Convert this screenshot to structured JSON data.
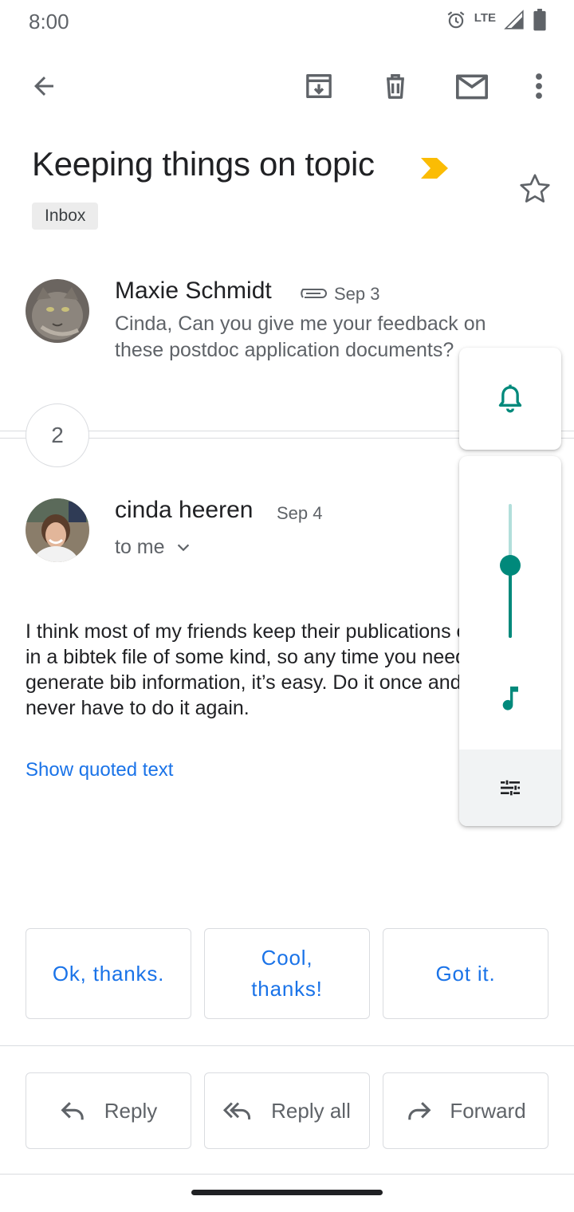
{
  "status_bar": {
    "time": "8:00",
    "network": "LTE"
  },
  "app_bar": {
    "back_icon": "arrow-back-icon",
    "archive_icon": "archive-icon",
    "delete_icon": "trash-icon",
    "mark_unread_icon": "mail-icon",
    "more_icon": "more-vert-icon"
  },
  "thread": {
    "subject": "Keeping things on topic",
    "label": "Inbox",
    "importance_color": "#fbbc04",
    "collapsed_count": "2"
  },
  "first_message": {
    "sender": "Maxie Schmidt",
    "date": "Sep 3",
    "has_attachment": true,
    "snippet": "Cinda, Can you give me your feedback on these postdoc application documents?"
  },
  "second_message": {
    "sender": "cinda heeren",
    "date": "Sep 4",
    "recipient": "to me",
    "body": "I think most of my friends keep their publications organized in a bibtek file of some kind, so any time you need to generate bib information, it’s easy. Do it once and you’ll never have to do it again.",
    "quoted_link": "Show quoted text"
  },
  "smart_replies": [
    "Ok, thanks.",
    "Cool, thanks!",
    "Got it."
  ],
  "actions": {
    "reply": "Reply",
    "reply_all": "Reply all",
    "forward": "Forward"
  },
  "volume_panel": {
    "ringer_icon": "bell-icon",
    "media_icon": "music-note-icon",
    "settings_icon": "tune-icon",
    "media_level": 0.54,
    "accent_color": "#00897b"
  }
}
